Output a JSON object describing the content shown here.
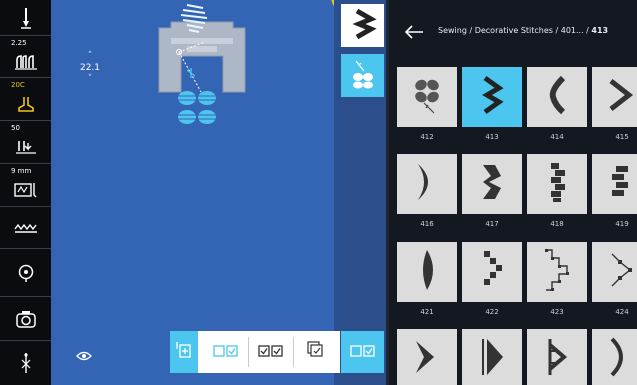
{
  "toolbar": {
    "items": [
      {
        "name": "needle-icon",
        "value": ""
      },
      {
        "name": "stitch-length-icon",
        "value": "2.25"
      },
      {
        "name": "presser-foot-icon",
        "value": "20C"
      },
      {
        "name": "thread-tension-icon",
        "value": "50"
      },
      {
        "name": "stitch-width-icon",
        "value": "9 mm"
      },
      {
        "name": "feed-dog-icon",
        "value": ""
      },
      {
        "name": "needle-position-icon",
        "value": ""
      },
      {
        "name": "camera-icon",
        "value": ""
      },
      {
        "name": "needle-stop-icon",
        "value": ""
      }
    ],
    "colors": {
      "accent_yellow": "#f0c419"
    }
  },
  "canvas": {
    "width_value": "22.1",
    "background": "#3465b5"
  },
  "action_bar": {
    "buttons": [
      "add-stitch-icon",
      "select-single-icon",
      "select-multiple-icon",
      "duplicate-icon"
    ]
  },
  "sequence": {
    "items": [
      "stitch-413-thumb",
      "stitch-flower-thumb"
    ],
    "bottom": "select-single-icon"
  },
  "panel": {
    "breadcrumb_prefix": "Sewing / Decorative Stitches / 401... / ",
    "breadcrumb_current": "413",
    "stitches": [
      {
        "label": "412",
        "icon": "flower-cross-stitch-icon",
        "selected": false
      },
      {
        "label": "413",
        "icon": "chevron-zigzag-stitch-icon",
        "selected": true
      },
      {
        "label": "414",
        "icon": "curve-satin-stitch-icon",
        "selected": false
      },
      {
        "label": "415",
        "icon": "arrow-satin-stitch-icon",
        "selected": false
      },
      {
        "label": "416",
        "icon": "crescent-satin-stitch-icon",
        "selected": false
      },
      {
        "label": "417",
        "icon": "zigzag-block-stitch-icon",
        "selected": false
      },
      {
        "label": "418",
        "icon": "wave-block-stitch-icon",
        "selected": false
      },
      {
        "label": "419",
        "icon": "stacked-block-stitch-icon",
        "selected": false
      },
      {
        "label": "421",
        "icon": "leaf-satin-stitch-icon",
        "selected": false
      },
      {
        "label": "422",
        "icon": "dashed-chevron-stitch-icon",
        "selected": false
      },
      {
        "label": "423",
        "icon": "outline-chevron-stitch-icon",
        "selected": false
      },
      {
        "label": "424",
        "icon": "outline-arrow-stitch-icon",
        "selected": false
      },
      {
        "label": "",
        "icon": "chevron-satin-stitch-icon",
        "selected": false
      },
      {
        "label": "",
        "icon": "fan-satin-stitch-icon",
        "selected": false
      },
      {
        "label": "",
        "icon": "comb-satin-stitch-icon",
        "selected": false
      },
      {
        "label": "",
        "icon": "bracket-satin-stitch-icon",
        "selected": false
      }
    ],
    "colors": {
      "selected": "#4cc6ef",
      "tile": "#dcdcdc"
    }
  }
}
